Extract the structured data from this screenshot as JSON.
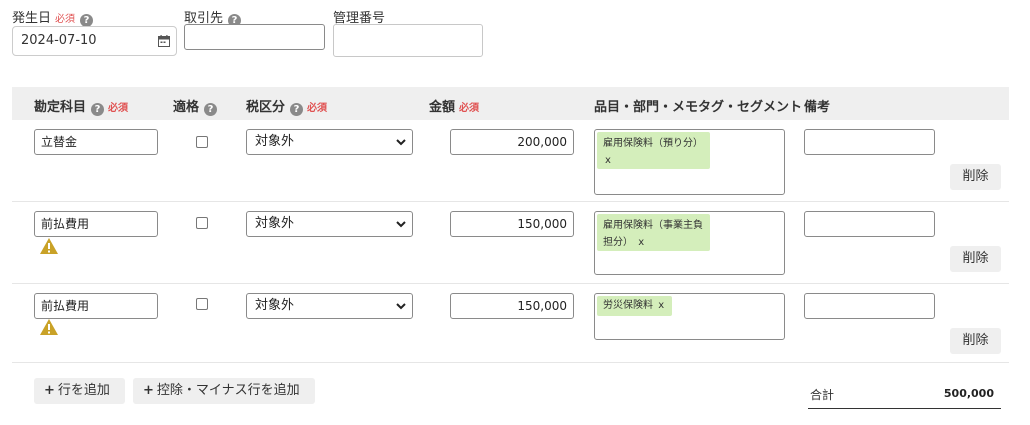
{
  "header": {
    "date": {
      "label": "発生日",
      "required": "必須",
      "value": "2024-07-10"
    },
    "partner": {
      "label": "取引先",
      "value": ""
    },
    "control_number": {
      "label": "管理番号",
      "value": ""
    }
  },
  "table": {
    "columns": {
      "account": "勘定科目",
      "account_required": "必須",
      "qualified": "適格",
      "tax": "税区分",
      "tax_required": "必須",
      "amount": "金額",
      "amount_required": "必須",
      "items": "品目・部門・メモタグ・セグメント",
      "memo": "備考"
    },
    "rows": [
      {
        "account": "立替金",
        "tax": "対象外",
        "amount": "200,000",
        "tags": [
          "雇用保険料（預り分）"
        ],
        "memo": "",
        "delete": "削除",
        "warning": false
      },
      {
        "account": "前払費用",
        "tax": "対象外",
        "amount": "150,000",
        "tags": [
          "雇用保険料（事業主負担分）"
        ],
        "memo": "",
        "delete": "削除",
        "warning": true
      },
      {
        "account": "前払費用",
        "tax": "対象外",
        "amount": "150,000",
        "tags": [
          "労災保険料"
        ],
        "memo": "",
        "delete": "削除",
        "warning": true
      }
    ],
    "tag_remove": "x"
  },
  "footer": {
    "add_row": "行を追加",
    "add_minus_row": "控除・マイナス行を追加",
    "total_label": "合計",
    "total_value": "500,000"
  },
  "icons": {
    "help": "help-icon",
    "calendar": "calendar-icon",
    "chevron": "chevron-down-icon",
    "warning": "warning-icon",
    "plus": "plus-icon"
  },
  "colors": {
    "required": "#e05252",
    "tag": "#d4eebb",
    "header_bg": "#efefef",
    "warning": "#c9a227"
  }
}
